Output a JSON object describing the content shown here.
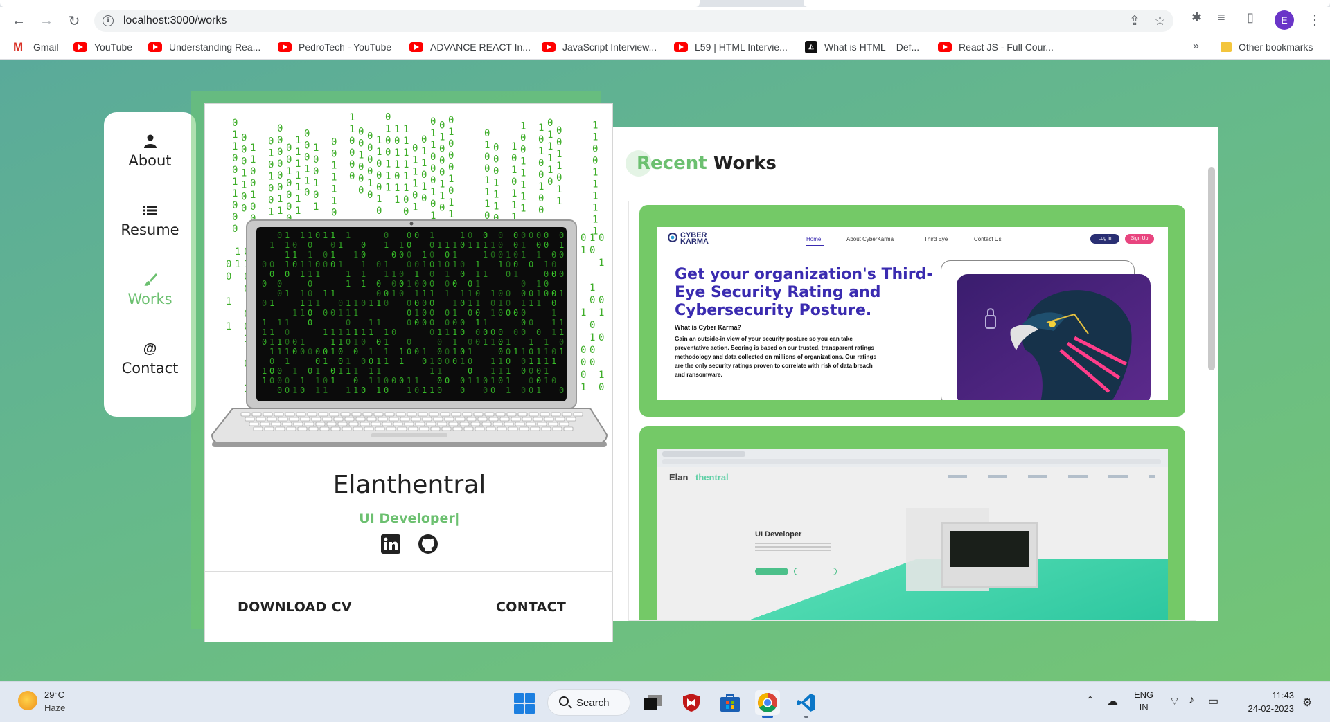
{
  "browser": {
    "url": "localhost:3000/works",
    "profile_initial": "E",
    "bookmarks": [
      {
        "label": "Gmail",
        "icon": "gmail"
      },
      {
        "label": "YouTube",
        "icon": "youtube"
      },
      {
        "label": "Understanding Rea...",
        "icon": "youtube"
      },
      {
        "label": "PedroTech - YouTube",
        "icon": "youtube"
      },
      {
        "label": "ADVANCE REACT In...",
        "icon": "youtube"
      },
      {
        "label": "JavaScript Interview...",
        "icon": "youtube"
      },
      {
        "label": "L59 | HTML Intervie...",
        "icon": "youtube"
      },
      {
        "label": "What is HTML – Def...",
        "icon": "w3"
      },
      {
        "label": "React JS - Full Cour...",
        "icon": "youtube"
      }
    ],
    "more": "»",
    "other_bookmarks": "Other bookmarks"
  },
  "sidenav": {
    "items": [
      {
        "label": "About",
        "icon": "user-icon"
      },
      {
        "label": "Resume",
        "icon": "list-icon"
      },
      {
        "label": "Works",
        "icon": "brush-icon",
        "active": true
      },
      {
        "label": "Contact",
        "icon": "at-icon"
      }
    ]
  },
  "profile": {
    "name": "Elanthentral",
    "role": "UI Developer|",
    "download_cv": "DOWNLOAD CV",
    "contact": "CONTACT"
  },
  "works": {
    "title_highlight": "Recent",
    "title_rest": " Works",
    "project1": {
      "logo": "CYBER KARMA",
      "nav": [
        "Home",
        "About CyberKarma",
        "Third Eye",
        "Contact Us"
      ],
      "login": "Log in",
      "signup": "Sign Up",
      "headline": "Get your organization's Third-Eye Security Rating and Cybersecurity Posture.",
      "subheading": "What is Cyber Karma?",
      "body": "Gain an outside-in view of your security posture so you can take preventative action. Scoring is based on our trusted, transparent ratings methodology and data collected on millions of organizations. Our ratings are the only security ratings proven to correlate with risk of data breach and ransomware."
    },
    "project2": {
      "logo_dark": "Elan",
      "logo_light": "thentral",
      "role": "UI Developer"
    }
  },
  "taskbar": {
    "temperature": "29°C",
    "weather": "Haze",
    "search": "Search",
    "lang_top": "ENG",
    "lang_bottom": "IN",
    "time": "11:43",
    "date": "24-02-2023"
  },
  "colors": {
    "accent": "#6cc070",
    "project_bg": "#74c967",
    "cyber_heading": "#3a2bb0"
  }
}
